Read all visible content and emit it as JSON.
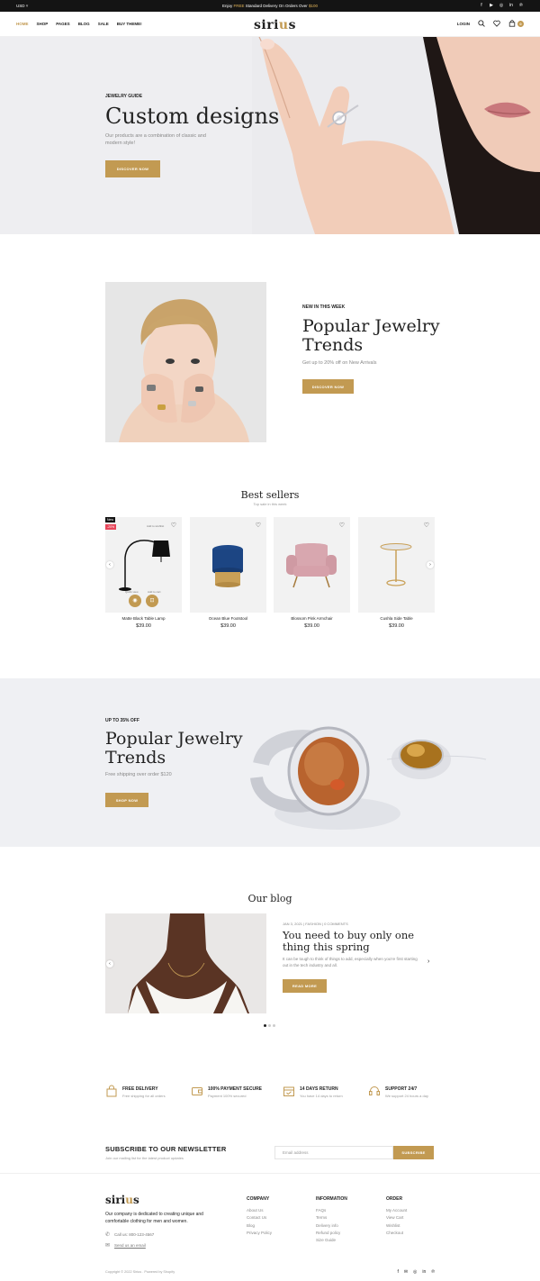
{
  "topbar": {
    "currency": "USD ˅",
    "promo_prefix": "Enjoy",
    "promo_highlight": "FREE",
    "promo_middle": "Standard Delivery On Orders Over",
    "promo_amount": "$100",
    "socials": [
      "f",
      "▶",
      "◎",
      "in",
      "℗"
    ]
  },
  "header": {
    "nav": [
      "HOME",
      "SHOP",
      "PAGES",
      "BLOG",
      "SALE",
      "BUY THEME!"
    ],
    "logo_a": "siri",
    "logo_b": "u",
    "logo_c": "s",
    "login": "LOGIN",
    "cart_count": "0"
  },
  "hero": {
    "kicker": "JEWELRY GUIDE",
    "title": "Custom designs",
    "desc": "Our products are a combination of classic and modern style!",
    "button": "DISCOVER NOW"
  },
  "trends": {
    "kicker": "NEW IN THIS WEEK",
    "title": "Popular Jewelry Trends",
    "desc": "Get up to 20% off on New Arrivals",
    "button": "DISCOVER NOW"
  },
  "bestsellers": {
    "title": "Best sellers",
    "subtitle": "Top sale in this week",
    "new_badge": "New",
    "sale_badge": "-20%",
    "wishlist_hint": "Add to wishlist",
    "quick_view": "Quick view",
    "add_to_cart": "Add to cart",
    "products": [
      {
        "name": "Matte Black Table Lamp",
        "price": "$39.00"
      },
      {
        "name": "Ocean Blue Footstool",
        "price": "$39.00"
      },
      {
        "name": "Blossom Pink Armchair",
        "price": "$39.00"
      },
      {
        "name": "Cushla Side Table",
        "price": "$39.00"
      }
    ]
  },
  "banner": {
    "kicker": "UP TO 35% OFF",
    "title": "Popular Jewelry Trends",
    "desc": "Free shipping over order $120",
    "button": "SHOP NOW"
  },
  "blog": {
    "title": "Our blog",
    "meta": "JAN 3, 2021 | FASHION | 0 COMMENTS",
    "post_title": "You need to buy only one thing this spring",
    "post_desc": "It can be tough to think of things to add, especially when you're first starting out in the tech industry and all.",
    "button": "READ MORE"
  },
  "features": [
    {
      "title": "FREE DELIVERY",
      "desc": "Free shipping for all orders"
    },
    {
      "title": "100% PAYMENT SECURE",
      "desc": "Payment 100% secured"
    },
    {
      "title": "14 DAYS RETURN",
      "desc": "You have 14 days to return"
    },
    {
      "title": "SUPPORT 24/7",
      "desc": "We support 24 hours a day"
    }
  ],
  "newsletter": {
    "title": "SUBSCRIBE TO OUR NEWSLETTER",
    "subtitle": "Join our mailing list for the latest product updates",
    "placeholder": "Email address",
    "button": "SUBSCRIBE"
  },
  "footer": {
    "logo_a": "siri",
    "logo_b": "u",
    "logo_c": "s",
    "about": "Our company is dedicated to creating unique and comfortable clothing for men and women.",
    "phone": "Call us: 800-123-4567",
    "email": "Send us an email",
    "columns": [
      {
        "heading": "COMPANY",
        "items": [
          "About Us",
          "Contact Us",
          "Blog",
          "Privacy Policy"
        ]
      },
      {
        "heading": "INFORMATION",
        "items": [
          "FAQs",
          "Terms",
          "Delivery info",
          "Refund policy",
          "Size Guide"
        ]
      },
      {
        "heading": "ORDER",
        "items": [
          "My Account",
          "View Cart",
          "Wishlist",
          "Checkout"
        ]
      }
    ],
    "copyright": "Copyright © 2022 Sirius . Powered by Shopify",
    "socials": [
      "f",
      "✉",
      "◎",
      "in",
      "℗"
    ]
  },
  "colors": {
    "accent": "#c29a52",
    "topbar": "#141414",
    "sale": "#e8465a"
  }
}
